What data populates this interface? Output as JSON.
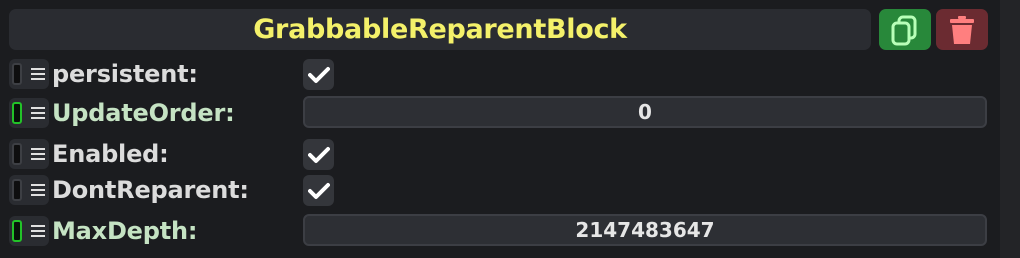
{
  "component": {
    "title": "GrabbableReparentBlock",
    "actions": {
      "duplicate_icon": "copy-icon",
      "delete_icon": "trash-icon",
      "duplicate_color": "#28883a",
      "delete_color": "#6b2b31"
    }
  },
  "fields": [
    {
      "label": "persistent:",
      "type": "checkbox",
      "checked": true,
      "linked": false
    },
    {
      "label": "UpdateOrder:",
      "type": "number",
      "value": "0",
      "linked": true
    },
    {
      "label": "Enabled:",
      "type": "checkbox",
      "checked": true,
      "linked": false
    },
    {
      "label": "DontReparent:",
      "type": "checkbox",
      "checked": true,
      "linked": false
    },
    {
      "label": "MaxDepth:",
      "type": "number",
      "value": "2147483647",
      "linked": true
    }
  ],
  "colors": {
    "title": "#f4f16a",
    "linked_label": "#c5e3c3",
    "linked_pin": "#22c328"
  }
}
